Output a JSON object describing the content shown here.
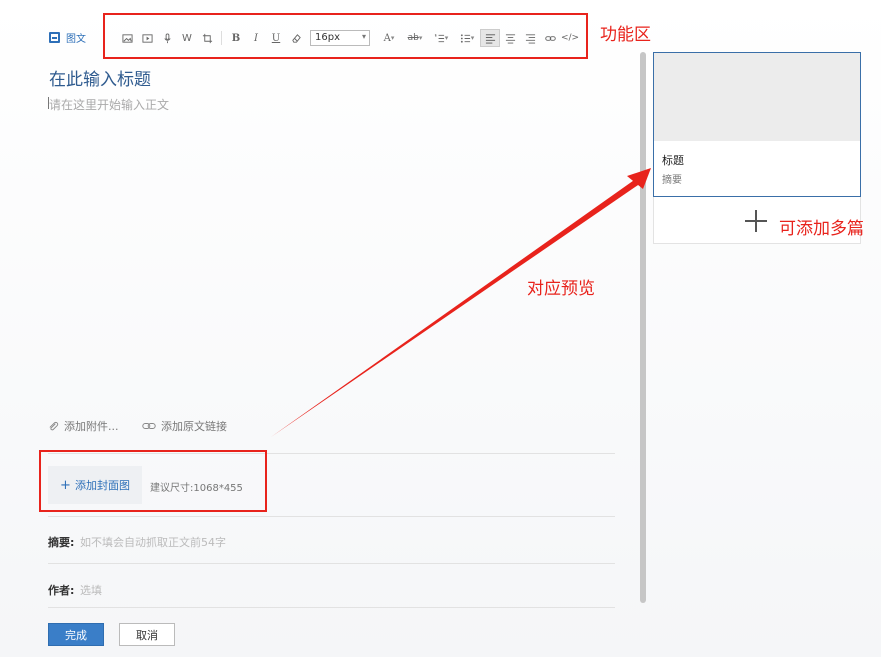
{
  "tab": {
    "label": "图文"
  },
  "toolbar": {
    "font_size": "16px",
    "word_icon": "W",
    "bold": "B",
    "italic": "I",
    "underline": "U",
    "font_color": "A",
    "highlight": "ab",
    "code": "</>"
  },
  "editor": {
    "title_placeholder": "在此输入标题",
    "body_placeholder": "请在这里开始输入正文",
    "attach_label": "添加附件...",
    "origin_link_label": "添加原文链接"
  },
  "cover": {
    "button_label": "添加封面图",
    "size_hint": "建议尺寸:1068*455"
  },
  "fields": {
    "digest_label": "摘要:",
    "digest_placeholder": "如不填会自动抓取正文前54字",
    "author_label": "作者:",
    "author_placeholder": "选填"
  },
  "actions": {
    "done_label": "完成",
    "cancel_label": "取消"
  },
  "preview": {
    "card_title": "标题",
    "card_digest": "摘要"
  },
  "annotations": {
    "toolbar_note": "功能区",
    "preview_note": "对应预览",
    "add_more_note": "可添加多篇"
  },
  "colors": {
    "accent": "#3a7ec8",
    "annotation_red": "#e8231c",
    "title_blue": "#2f5b8f"
  },
  "icons": [
    "doc-tab-icon",
    "image-icon",
    "video-icon",
    "audio-icon",
    "word-icon",
    "crop-icon",
    "bold-icon",
    "italic-icon",
    "underline-icon",
    "eraser-icon",
    "font-color-icon",
    "highlight-icon",
    "ordered-list-icon",
    "unordered-list-icon",
    "align-left-icon",
    "align-center-icon",
    "align-right-icon",
    "link-icon",
    "code-icon",
    "paperclip-icon",
    "chain-icon",
    "plus-icon"
  ]
}
